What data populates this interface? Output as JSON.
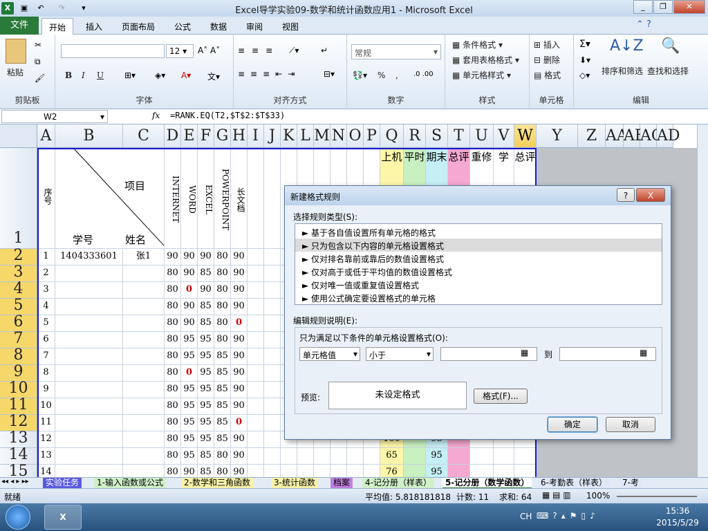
{
  "window": {
    "title": "Excel导学实验09-数学和统计函数应用1 - Microsoft Excel"
  },
  "ribbon_tabs": [
    "开始",
    "插入",
    "页面布局",
    "公式",
    "数据",
    "审阅",
    "视图"
  ],
  "file_tab": "文件",
  "ribbon": {
    "clipboard": {
      "label": "剪贴板",
      "paste": "粘贴"
    },
    "font": {
      "label": "字体",
      "size": "12",
      "bold": "B",
      "italic": "I",
      "underline": "U"
    },
    "align": {
      "label": "对齐方式"
    },
    "number": {
      "label": "数字",
      "format": "常规",
      "percent": "%",
      "comma": ","
    },
    "styles": {
      "label": "样式",
      "cond": "条件格式",
      "table": "套用表格格式",
      "cell": "单元格样式"
    },
    "cells": {
      "label": "单元格",
      "insert": "插入",
      "delete": "删除",
      "format": "格式"
    },
    "edit": {
      "label": "编辑",
      "sort": "排序和筛选",
      "find": "查找和选择"
    }
  },
  "formula_bar": {
    "name_box": "W2",
    "fx": "fx",
    "formula": "=RANK.EQ(T2,$T$2:$T$33)"
  },
  "columns": [
    "A",
    "B",
    "C",
    "D",
    "E",
    "F",
    "G",
    "H",
    "I",
    "J",
    "K",
    "L",
    "M",
    "N",
    "O",
    "P",
    "Q",
    "R",
    "S",
    "T",
    "U",
    "V",
    "W",
    "Y",
    "Z",
    "AA",
    "AE",
    "AC",
    "AD"
  ],
  "header_row": {
    "row_num": "1",
    "seq": "序号",
    "project": "项目",
    "id": "学号",
    "name": "姓名",
    "subjects": [
      "INTERNET",
      "WORD",
      "EXCEL",
      "POWERPOINT",
      "长文档"
    ],
    "right": [
      "上机",
      "平时",
      "期末",
      "总评",
      "重修",
      "学",
      "总评"
    ]
  },
  "rows": [
    {
      "r": "2",
      "seq": "1",
      "id": "1404333601",
      "name": "张1",
      "v": [
        "90",
        "90",
        "90",
        "80",
        "90"
      ]
    },
    {
      "r": "3",
      "seq": "2",
      "v": [
        "80",
        "90",
        "85",
        "80",
        "90"
      ]
    },
    {
      "r": "4",
      "seq": "3",
      "v": [
        "80",
        "0",
        "90",
        "80",
        "90"
      ]
    },
    {
      "r": "5",
      "seq": "4",
      "v": [
        "80",
        "90",
        "85",
        "80",
        "90"
      ]
    },
    {
      "r": "6",
      "seq": "5",
      "v": [
        "80",
        "90",
        "85",
        "80",
        "0"
      ]
    },
    {
      "r": "7",
      "seq": "6",
      "v": [
        "80",
        "95",
        "95",
        "80",
        "90"
      ]
    },
    {
      "r": "8",
      "seq": "7",
      "v": [
        "80",
        "95",
        "95",
        "85",
        "90"
      ]
    },
    {
      "r": "9",
      "seq": "8",
      "v": [
        "80",
        "0",
        "95",
        "85",
        "90"
      ]
    },
    {
      "r": "10",
      "seq": "9",
      "v": [
        "80",
        "95",
        "95",
        "85",
        "90"
      ]
    },
    {
      "r": "11",
      "seq": "10",
      "v": [
        "80",
        "95",
        "95",
        "85",
        "90"
      ]
    },
    {
      "r": "12",
      "seq": "11",
      "v": [
        "80",
        "95",
        "95",
        "85",
        "0"
      ]
    },
    {
      "r": "13",
      "seq": "12",
      "v": [
        "80",
        "95",
        "95",
        "85",
        "90"
      ],
      "q": "100",
      "s": "95"
    },
    {
      "r": "14",
      "seq": "13",
      "v": [
        "80",
        "95",
        "85",
        "80",
        "90"
      ],
      "q": "65",
      "s": "95"
    },
    {
      "r": "15",
      "seq": "14",
      "v": [
        "80",
        "90",
        "85",
        "80",
        "90"
      ],
      "q": "76",
      "s": "95"
    }
  ],
  "sheets": [
    "实验任务",
    "1-输入函数或公式",
    "2-数学和三角函数",
    "3-统计函数",
    "档案",
    "4-记分册（样表）",
    "5-记分册（数学函数）",
    "6-考勤表（样表）",
    "7-考"
  ],
  "status": {
    "ready": "就绪",
    "avg": "平均值: 5.818181818",
    "count": "计数: 11",
    "sum": "求和: 64",
    "zoom": "100%"
  },
  "clock": {
    "time": "15:36",
    "date": "2015/5/29",
    "lang": "CH"
  },
  "dialog": {
    "title": "新建格式规则",
    "select_label": "选择规则类型(S):",
    "rules": [
      "► 基于各自值设置所有单元格的格式",
      "► 只为包含以下内容的单元格设置格式",
      "► 仅对排名靠前或靠后的数值设置格式",
      "► 仅对高于或低于平均值的数值设置格式",
      "► 仅对唯一值或重复值设置格式",
      "► 使用公式确定要设置格式的单元格"
    ],
    "selected_rule": 1,
    "edit_label": "编辑规则说明(E):",
    "cond_label": "只为满足以下条件的单元格设置格式(O):",
    "field1": "单元格值",
    "field2": "小于",
    "to": "到",
    "preview_label": "预览:",
    "preview_text": "未设定格式",
    "format_btn": "格式(F)...",
    "ok": "确定",
    "cancel": "取消",
    "help": "?",
    "close": "X"
  }
}
